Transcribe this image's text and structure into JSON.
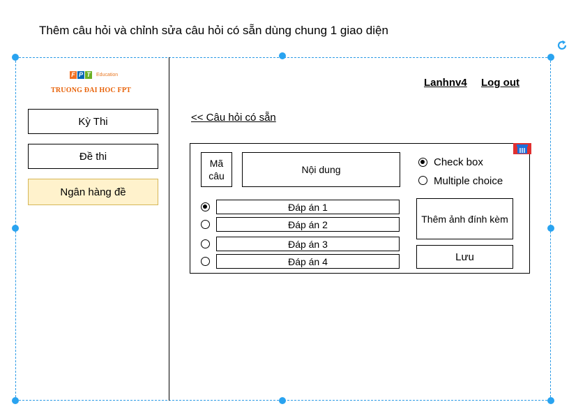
{
  "caption": "Thêm câu hỏi và chỉnh sửa câu hỏi có sẵn dùng chung 1 giao diện",
  "logo": {
    "letters": [
      "F",
      "P",
      "T"
    ],
    "letter_colors": [
      "#f26f21",
      "#0066b3",
      "#6ab023"
    ],
    "edu": "Education",
    "school": "TRUONG ĐAI HOC FPT"
  },
  "sidebar": {
    "items": [
      {
        "label": "Kỳ Thi",
        "active": false
      },
      {
        "label": "Đề thi",
        "active": false
      },
      {
        "label": "Ngân hàng đề",
        "active": true
      }
    ]
  },
  "header": {
    "user": "Lanhnv4",
    "logout": "Log out"
  },
  "back_link": "<< Câu hỏi có sẵn",
  "editor": {
    "code_label": "Mã câu",
    "content_label": "Nội dung",
    "type_options": [
      {
        "label": "Check box",
        "selected": true
      },
      {
        "label": "Multiple choice",
        "selected": false
      }
    ],
    "answers": [
      {
        "label": "Đáp án 1",
        "selected": true
      },
      {
        "label": "Đáp án 2",
        "selected": false
      },
      {
        "label": "Đáp án 3",
        "selected": false
      },
      {
        "label": "Đáp án 4",
        "selected": false
      }
    ],
    "attach_label": "Thêm ảnh đính kèm",
    "save_label": "Lưu"
  },
  "colors": {
    "selection": "#29a3f0",
    "active_nav_bg": "#fff2cc",
    "active_nav_border": "#d6b656",
    "trash": "#1e6fd9"
  },
  "icons": {
    "rotate": "rotate-icon",
    "trash": "trash-icon"
  }
}
